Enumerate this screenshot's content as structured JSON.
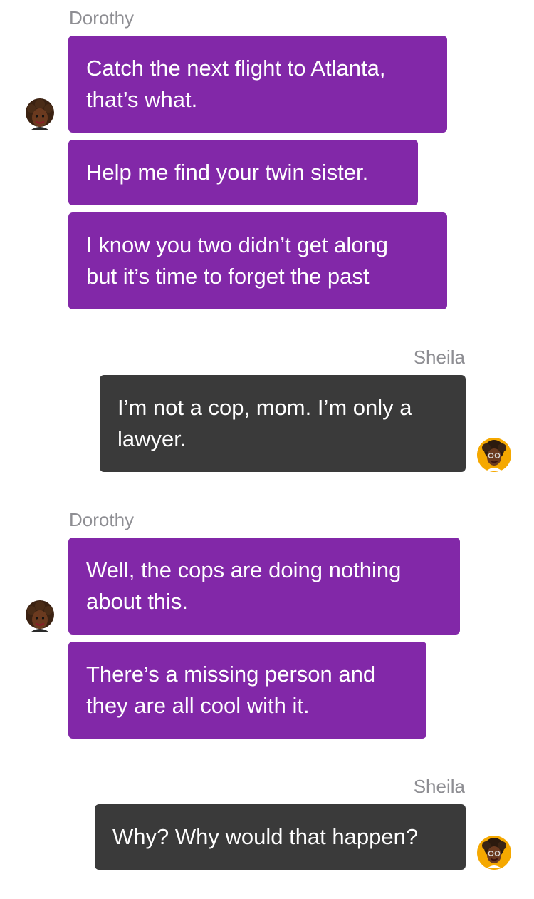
{
  "conversation": {
    "groups": [
      {
        "sender": "Dorothy",
        "messages": [
          {
            "lines": [
              "Catch the next flight to Atlanta,",
              "that’s what."
            ]
          },
          {
            "lines": [
              "Help me find your twin sister."
            ]
          },
          {
            "lines": [
              "I know you two didn’t get along",
              "but it’s time to forget the past"
            ]
          }
        ]
      },
      {
        "sender": "Sheila",
        "messages": [
          {
            "lines": [
              "I’m not a cop, mom. I’m only a",
              "lawyer."
            ]
          }
        ]
      },
      {
        "sender": "Dorothy",
        "messages": [
          {
            "lines": [
              "Well, the cops are doing nothing",
              "about this."
            ]
          },
          {
            "lines": [
              "There’s a missing person and",
              "they are all cool with it."
            ]
          }
        ]
      },
      {
        "sender": "Sheila",
        "messages": [
          {
            "lines": [
              "Why? Why would that happen?"
            ]
          }
        ]
      }
    ]
  },
  "colors": {
    "dorothy_bubble": "#8228a8",
    "sheila_bubble": "#3a3a3a",
    "sender_name": "#8e8e93",
    "sheila_avatar_bg": "#f5a800"
  },
  "icons": {
    "dorothy_avatar": "dorothy-avatar-icon",
    "sheila_avatar": "sheila-avatar-icon"
  }
}
